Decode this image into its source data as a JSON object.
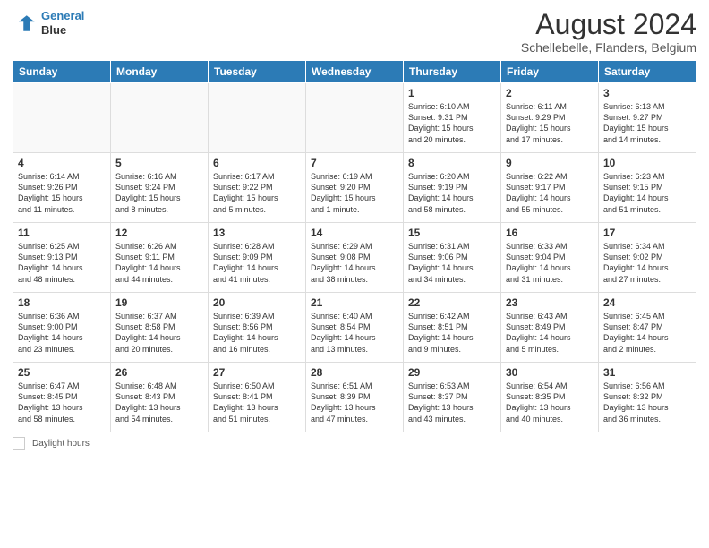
{
  "header": {
    "logo_line1": "General",
    "logo_line2": "Blue",
    "month_year": "August 2024",
    "location": "Schellebelle, Flanders, Belgium"
  },
  "days_of_week": [
    "Sunday",
    "Monday",
    "Tuesday",
    "Wednesday",
    "Thursday",
    "Friday",
    "Saturday"
  ],
  "weeks": [
    [
      {
        "day": "",
        "info": ""
      },
      {
        "day": "",
        "info": ""
      },
      {
        "day": "",
        "info": ""
      },
      {
        "day": "",
        "info": ""
      },
      {
        "day": "1",
        "info": "Sunrise: 6:10 AM\nSunset: 9:31 PM\nDaylight: 15 hours\nand 20 minutes."
      },
      {
        "day": "2",
        "info": "Sunrise: 6:11 AM\nSunset: 9:29 PM\nDaylight: 15 hours\nand 17 minutes."
      },
      {
        "day": "3",
        "info": "Sunrise: 6:13 AM\nSunset: 9:27 PM\nDaylight: 15 hours\nand 14 minutes."
      }
    ],
    [
      {
        "day": "4",
        "info": "Sunrise: 6:14 AM\nSunset: 9:26 PM\nDaylight: 15 hours\nand 11 minutes."
      },
      {
        "day": "5",
        "info": "Sunrise: 6:16 AM\nSunset: 9:24 PM\nDaylight: 15 hours\nand 8 minutes."
      },
      {
        "day": "6",
        "info": "Sunrise: 6:17 AM\nSunset: 9:22 PM\nDaylight: 15 hours\nand 5 minutes."
      },
      {
        "day": "7",
        "info": "Sunrise: 6:19 AM\nSunset: 9:20 PM\nDaylight: 15 hours\nand 1 minute."
      },
      {
        "day": "8",
        "info": "Sunrise: 6:20 AM\nSunset: 9:19 PM\nDaylight: 14 hours\nand 58 minutes."
      },
      {
        "day": "9",
        "info": "Sunrise: 6:22 AM\nSunset: 9:17 PM\nDaylight: 14 hours\nand 55 minutes."
      },
      {
        "day": "10",
        "info": "Sunrise: 6:23 AM\nSunset: 9:15 PM\nDaylight: 14 hours\nand 51 minutes."
      }
    ],
    [
      {
        "day": "11",
        "info": "Sunrise: 6:25 AM\nSunset: 9:13 PM\nDaylight: 14 hours\nand 48 minutes."
      },
      {
        "day": "12",
        "info": "Sunrise: 6:26 AM\nSunset: 9:11 PM\nDaylight: 14 hours\nand 44 minutes."
      },
      {
        "day": "13",
        "info": "Sunrise: 6:28 AM\nSunset: 9:09 PM\nDaylight: 14 hours\nand 41 minutes."
      },
      {
        "day": "14",
        "info": "Sunrise: 6:29 AM\nSunset: 9:08 PM\nDaylight: 14 hours\nand 38 minutes."
      },
      {
        "day": "15",
        "info": "Sunrise: 6:31 AM\nSunset: 9:06 PM\nDaylight: 14 hours\nand 34 minutes."
      },
      {
        "day": "16",
        "info": "Sunrise: 6:33 AM\nSunset: 9:04 PM\nDaylight: 14 hours\nand 31 minutes."
      },
      {
        "day": "17",
        "info": "Sunrise: 6:34 AM\nSunset: 9:02 PM\nDaylight: 14 hours\nand 27 minutes."
      }
    ],
    [
      {
        "day": "18",
        "info": "Sunrise: 6:36 AM\nSunset: 9:00 PM\nDaylight: 14 hours\nand 23 minutes."
      },
      {
        "day": "19",
        "info": "Sunrise: 6:37 AM\nSunset: 8:58 PM\nDaylight: 14 hours\nand 20 minutes."
      },
      {
        "day": "20",
        "info": "Sunrise: 6:39 AM\nSunset: 8:56 PM\nDaylight: 14 hours\nand 16 minutes."
      },
      {
        "day": "21",
        "info": "Sunrise: 6:40 AM\nSunset: 8:54 PM\nDaylight: 14 hours\nand 13 minutes."
      },
      {
        "day": "22",
        "info": "Sunrise: 6:42 AM\nSunset: 8:51 PM\nDaylight: 14 hours\nand 9 minutes."
      },
      {
        "day": "23",
        "info": "Sunrise: 6:43 AM\nSunset: 8:49 PM\nDaylight: 14 hours\nand 5 minutes."
      },
      {
        "day": "24",
        "info": "Sunrise: 6:45 AM\nSunset: 8:47 PM\nDaylight: 14 hours\nand 2 minutes."
      }
    ],
    [
      {
        "day": "25",
        "info": "Sunrise: 6:47 AM\nSunset: 8:45 PM\nDaylight: 13 hours\nand 58 minutes."
      },
      {
        "day": "26",
        "info": "Sunrise: 6:48 AM\nSunset: 8:43 PM\nDaylight: 13 hours\nand 54 minutes."
      },
      {
        "day": "27",
        "info": "Sunrise: 6:50 AM\nSunset: 8:41 PM\nDaylight: 13 hours\nand 51 minutes."
      },
      {
        "day": "28",
        "info": "Sunrise: 6:51 AM\nSunset: 8:39 PM\nDaylight: 13 hours\nand 47 minutes."
      },
      {
        "day": "29",
        "info": "Sunrise: 6:53 AM\nSunset: 8:37 PM\nDaylight: 13 hours\nand 43 minutes."
      },
      {
        "day": "30",
        "info": "Sunrise: 6:54 AM\nSunset: 8:35 PM\nDaylight: 13 hours\nand 40 minutes."
      },
      {
        "day": "31",
        "info": "Sunrise: 6:56 AM\nSunset: 8:32 PM\nDaylight: 13 hours\nand 36 minutes."
      }
    ]
  ],
  "footer": {
    "daylight_label": "Daylight hours"
  }
}
